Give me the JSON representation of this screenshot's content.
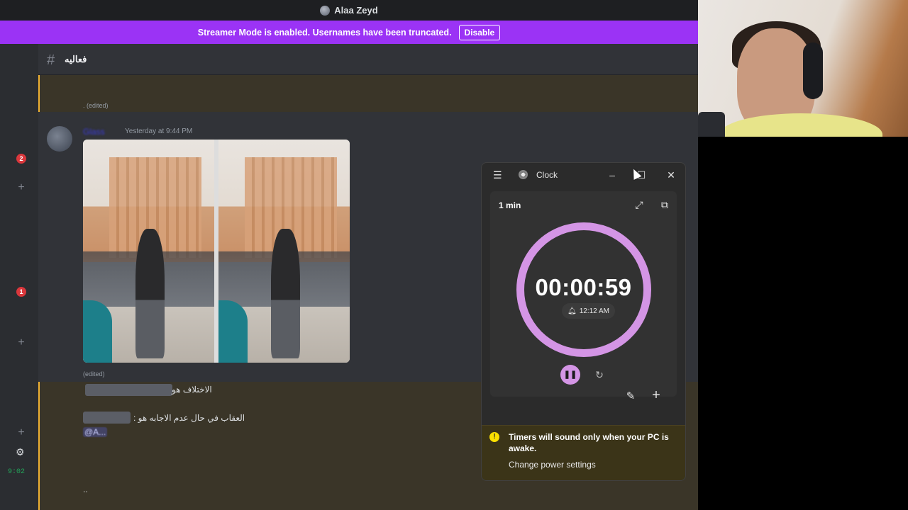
{
  "discord": {
    "window_title": "Alaa Zeyd",
    "streamer_notice": "Streamer Mode is enabled. Usernames have been truncated.",
    "disable_label": "Disable",
    "channel_name": "فعاليه",
    "rail": {
      "badge_top": "2",
      "badge_bottom": "1",
      "time": "9:02"
    },
    "messages": {
      "first_edited": ". (edited)",
      "username": "Glass",
      "timestamp": "Yesterday at 9:44 PM",
      "image_edited": "(edited)",
      "line1": "الاختلاف هو",
      "line2": "العقاب في حال عدم الاجابه هو :",
      "mention": "@A...",
      "last_line": ".."
    }
  },
  "clock": {
    "app_title": "Clock",
    "timer_label": "1 min",
    "countdown": "00:00:59",
    "alarm_time": "12:12 AM",
    "notice_text": "Timers will sound only when your PC is awake.",
    "notice_link": "Change power settings",
    "accent_color": "#d495e5",
    "icons": {
      "menu": "hamburger-icon",
      "minimize": "minimize-icon",
      "maximize": "maximize-icon",
      "close": "close-icon",
      "expand": "expand-icon",
      "compact": "compact-overlay-icon",
      "pause": "pause-icon",
      "reset": "reset-icon",
      "edit": "pencil-icon",
      "add": "plus-icon",
      "warning": "warning-icon",
      "bell": "bell-icon"
    }
  },
  "colors": {
    "streamer_bar": "#9b33f5",
    "discord_bg": "#313338",
    "mention_highlight": "#f0b232",
    "badge_red": "#da373c",
    "status_green": "#23a55a"
  }
}
